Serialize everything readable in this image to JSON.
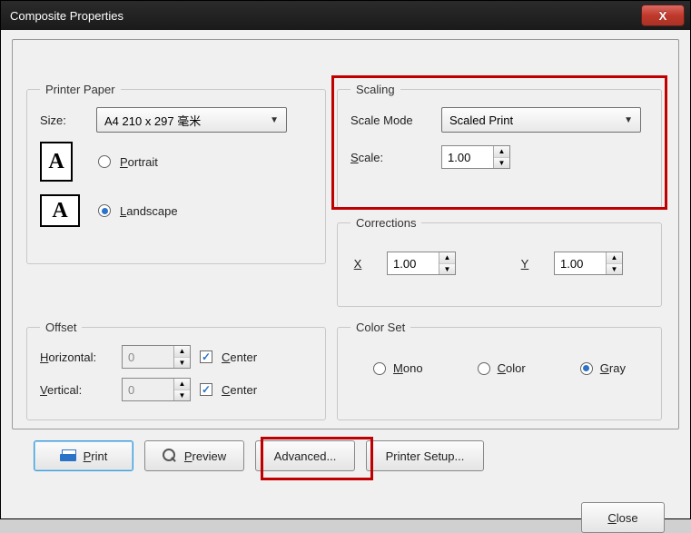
{
  "window": {
    "title": "Composite Properties",
    "close_glyph": "X"
  },
  "printer_paper": {
    "legend": "Printer Paper",
    "size_label": "Size:",
    "size_value": "A4 210 x 297 毫米",
    "orientation": {
      "portrait_label": "Portrait",
      "landscape_label": "Landscape",
      "selected": "landscape"
    }
  },
  "scaling": {
    "legend": "Scaling",
    "scale_mode_label": "Scale Mode",
    "scale_mode_value": "Scaled Print",
    "scale_label": "Scale:",
    "scale_value": "1.00"
  },
  "corrections": {
    "legend": "Corrections",
    "x_label": "X",
    "x_value": "1.00",
    "y_label": "Y",
    "y_value": "1.00"
  },
  "offset": {
    "legend": "Offset",
    "horizontal_label": "Horizontal:",
    "horizontal_value": "0",
    "horizontal_center_label": "Center",
    "horizontal_center_checked": true,
    "vertical_label": "Vertical:",
    "vertical_value": "0",
    "vertical_center_label": "Center",
    "vertical_center_checked": true
  },
  "color_set": {
    "legend": "Color Set",
    "mono_label": "Mono",
    "color_label": "Color",
    "gray_label": "Gray",
    "selected": "gray"
  },
  "buttons": {
    "print": "Print",
    "preview": "Preview",
    "advanced": "Advanced...",
    "printer_setup": "Printer Setup...",
    "close": "Close"
  }
}
